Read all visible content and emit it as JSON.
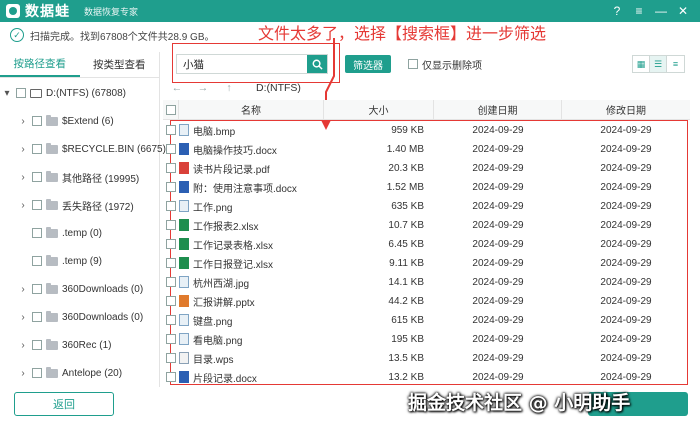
{
  "app": {
    "name": "数据蛙",
    "subtitle": "数据恢复专家",
    "window_controls": {
      "help": "?",
      "menu": "≡",
      "minimize": "—",
      "close": "✕"
    }
  },
  "status": {
    "text": "扫描完成。找到67808个文件共28.9 GB。"
  },
  "annotation": {
    "text": "文件太多了，选择【搜索框】进一步筛选",
    "color": "#e53935"
  },
  "sidebar": {
    "tabs": [
      {
        "label": "按路径查看",
        "active": true
      },
      {
        "label": "按类型查看",
        "active": false
      }
    ],
    "tree": [
      {
        "label": "D:(NTFS) (67808)",
        "kind": "drive",
        "expanded": true
      },
      {
        "label": "$Extend (6)",
        "kind": "folder"
      },
      {
        "label": "$RECYCLE.BIN (6675)",
        "kind": "folder"
      },
      {
        "label": "其他路径 (19995)",
        "kind": "folder"
      },
      {
        "label": "丢失路径 (1972)",
        "kind": "folder"
      },
      {
        "label": ".temp (0)",
        "kind": "folder"
      },
      {
        "label": ".temp (9)",
        "kind": "folder"
      },
      {
        "label": "360Downloads (0)",
        "kind": "folder"
      },
      {
        "label": "360Downloads (0)",
        "kind": "folder"
      },
      {
        "label": "360Rec (1)",
        "kind": "folder"
      },
      {
        "label": "Antelope (20)",
        "kind": "folder"
      }
    ]
  },
  "toolbar": {
    "search_value": "小猫",
    "filter_label": "筛选器",
    "only_deleted_label": "仅显示删除项"
  },
  "nav": {
    "path": "D:(NTFS)"
  },
  "table": {
    "columns": [
      "名称",
      "大小",
      "创建日期",
      "修改日期"
    ],
    "rows": [
      {
        "name": "电脑.bmp",
        "size": "959 KB",
        "created": "2024-09-29",
        "modified": "2024-09-29",
        "icon": "img"
      },
      {
        "name": "电脑操作技巧.docx",
        "size": "1.40 MB",
        "created": "2024-09-29",
        "modified": "2024-09-29",
        "icon": "word"
      },
      {
        "name": "读书片段记录.pdf",
        "size": "20.3 KB",
        "created": "2024-09-29",
        "modified": "2024-09-29",
        "icon": "pdf"
      },
      {
        "name": "附：使用注意事项.docx",
        "size": "1.52 MB",
        "created": "2024-09-29",
        "modified": "2024-09-29",
        "icon": "word"
      },
      {
        "name": "工作.png",
        "size": "635 KB",
        "created": "2024-09-29",
        "modified": "2024-09-29",
        "icon": "img"
      },
      {
        "name": "工作报表2.xlsx",
        "size": "10.7 KB",
        "created": "2024-09-29",
        "modified": "2024-09-29",
        "icon": "excel"
      },
      {
        "name": "工作记录表格.xlsx",
        "size": "6.45 KB",
        "created": "2024-09-29",
        "modified": "2024-09-29",
        "icon": "excel"
      },
      {
        "name": "工作日报登记.xlsx",
        "size": "9.11 KB",
        "created": "2024-09-29",
        "modified": "2024-09-29",
        "icon": "excel"
      },
      {
        "name": "杭州西湖.jpg",
        "size": "14.1 KB",
        "created": "2024-09-29",
        "modified": "2024-09-29",
        "icon": "img"
      },
      {
        "name": "汇报讲解.pptx",
        "size": "44.2 KB",
        "created": "2024-09-29",
        "modified": "2024-09-29",
        "icon": "ppt"
      },
      {
        "name": "键盘.png",
        "size": "615 KB",
        "created": "2024-09-29",
        "modified": "2024-09-29",
        "icon": "img"
      },
      {
        "name": "看电脑.png",
        "size": "195 KB",
        "created": "2024-09-29",
        "modified": "2024-09-29",
        "icon": "img"
      },
      {
        "name": "目录.wps",
        "size": "13.5 KB",
        "created": "2024-09-29",
        "modified": "2024-09-29",
        "icon": "wps"
      },
      {
        "name": "片段记录.docx",
        "size": "13.2 KB",
        "created": "2024-09-29",
        "modified": "2024-09-29",
        "icon": "word"
      }
    ]
  },
  "footer": {
    "back_label": "返回"
  },
  "watermark": {
    "text": "掘金技术社区 @ 小明助手"
  },
  "colors": {
    "accent": "#1f9e8d",
    "annotation": "#e53935"
  }
}
